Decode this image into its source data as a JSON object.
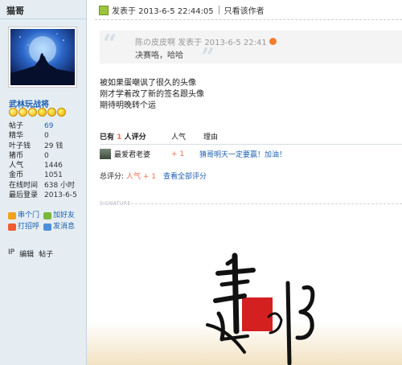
{
  "user": {
    "name": "猫哥",
    "rank": "武林玩战将",
    "stats": [
      {
        "label": "帖子",
        "value": "69",
        "link": true
      },
      {
        "label": "精华",
        "value": "0",
        "link": false
      },
      {
        "label": "叶子钱",
        "value": "29 钱",
        "link": false
      },
      {
        "label": "猪币",
        "value": "0",
        "link": false
      },
      {
        "label": "人气",
        "value": "1446",
        "link": false
      },
      {
        "label": "金币",
        "value": "1051",
        "link": false
      },
      {
        "label": "在线时间",
        "value": "638 小时",
        "link": false
      },
      {
        "label": "最后登录",
        "value": "2013-6-5",
        "link": false
      }
    ],
    "actions": {
      "visit": "串个门",
      "add_friend": "加好友",
      "poke": "打招呼",
      "message": "发消息"
    },
    "footer": {
      "ip": "IP",
      "edit": "编辑",
      "posts": "帖子"
    }
  },
  "post": {
    "posted_at": "发表于 2013-6-5 22:44:05",
    "only_author": "只看该作者",
    "quote": {
      "header": "陈の皮皮啊 发表于 2013-6-5 22:41",
      "body": "决赛咯，哈哈"
    },
    "lines": [
      "被如果蛋嘲讽了很久的头像",
      "刚才学着改了新的签名跟头像",
      "期待明晚转个运"
    ]
  },
  "rating": {
    "header_prefix": "已有",
    "count": "1",
    "header_suffix": "人评分",
    "col_popularity": "人气",
    "col_reason": "理由",
    "rows": [
      {
        "user": "最爱君老婆",
        "value": "+ 1",
        "reason": "猜哥明天一定要赢！加油！"
      }
    ],
    "total_label": "总评分:",
    "total_value": "人气 + 1",
    "view_all": "查看全部评分"
  },
  "signature": {
    "label": "SIGNATURE"
  },
  "colors": {
    "sidebar_bg": "#e5edf2",
    "link_blue": "#1e5fb0",
    "rating_orange": "#f26c4f",
    "signature_red": "#d42020"
  }
}
